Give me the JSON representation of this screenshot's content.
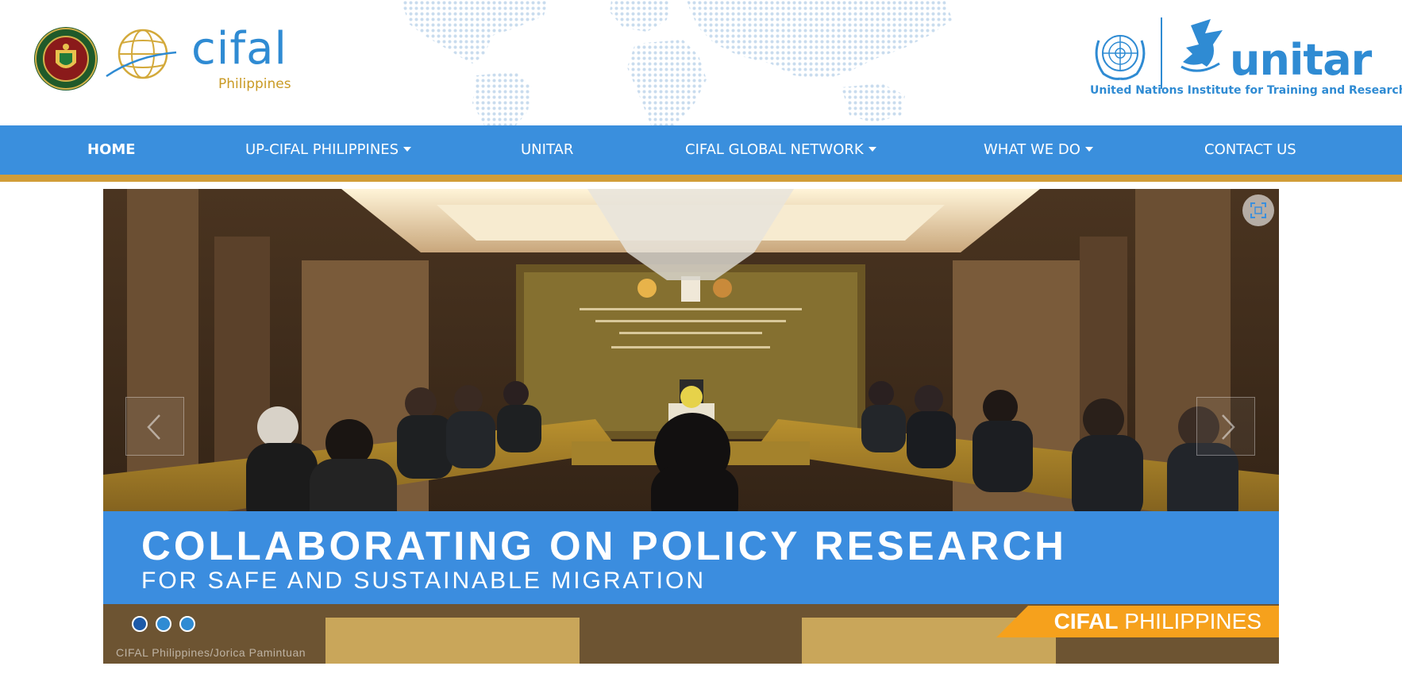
{
  "header": {
    "cifal_logo_text": "cifal",
    "cifal_logo_subtext": "Philippines",
    "unitar_logo_text": "unitar",
    "unitar_tagline": "United Nations Institute for Training and Research"
  },
  "nav": {
    "items": [
      {
        "label": "HOME",
        "active": true,
        "has_dropdown": false
      },
      {
        "label": "UP-CIFAL PHILIPPINES",
        "active": false,
        "has_dropdown": true
      },
      {
        "label": "UNITAR",
        "active": false,
        "has_dropdown": false
      },
      {
        "label": "CIFAL GLOBAL NETWORK",
        "active": false,
        "has_dropdown": true
      },
      {
        "label": "WHAT WE DO",
        "active": false,
        "has_dropdown": true
      },
      {
        "label": "CONTACT US",
        "active": false,
        "has_dropdown": false
      }
    ]
  },
  "carousel": {
    "caption_title": "COLLABORATING ON POLICY RESEARCH",
    "caption_subtitle": "FOR SAFE AND SUSTAINABLE MIGRATION",
    "brand_bold": "CIFAL",
    "brand_rest": " PHILIPPINES",
    "photo_credit": "CIFAL Philippines/Jorica Pamintuan",
    "slide_count": 3,
    "active_slide": 1,
    "icons": {
      "prev": "chevron-left-icon",
      "next": "chevron-right-icon",
      "fullscreen": "fullscreen-icon"
    }
  },
  "colors": {
    "brand_blue": "#3a8fdd",
    "gold": "#d19d38",
    "orange": "#f6a11c"
  }
}
